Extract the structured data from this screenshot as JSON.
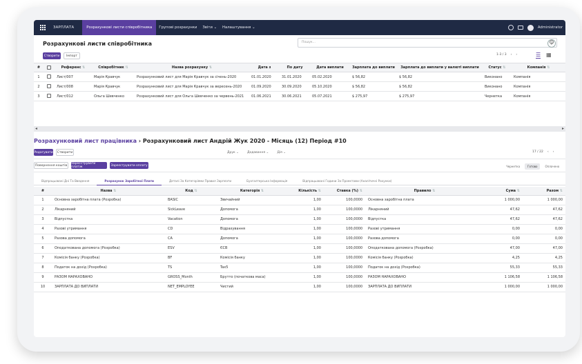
{
  "nav": {
    "brand": "ЗАРПЛАТА",
    "items": [
      "Розрахункові листи співробітника",
      "Групові розрахунки",
      "Звіти ⌄",
      "Налаштування ⌄"
    ],
    "user": "Administrator"
  },
  "list_view": {
    "title": "Розрахункові листи співробітника",
    "create_label": "Створити",
    "import_label": "Імпорт",
    "search_placeholder": "Пошук...",
    "pager": "1-3 / 3",
    "columns": [
      "#",
      "Референс",
      "Співробітник",
      "Назва розрахунку",
      "Дата з",
      "По дату",
      "Дата виплати",
      "Зарплата до виплати",
      "Зарплата до виплати у валюті виплати",
      "Статус",
      "Компанія"
    ],
    "rows": [
      {
        "n": "1",
        "ref": "Лист/007",
        "emp": "Марія Кравчук",
        "name": "Розрахунковий лист для Марія Кравчук за січень-2020",
        "from": "01.01.2020",
        "to": "31.01.2020",
        "pay": "05.02.2020",
        "net": "$ 56,82",
        "net_cur": "$ 56,82",
        "status": "Виконано",
        "company": "Компанія"
      },
      {
        "n": "2",
        "ref": "Лист/008",
        "emp": "Марія Кравчук",
        "name": "Розрахунковий лист для Марія Кравчук за вересень-2020",
        "from": "01.09.2020",
        "to": "30.09.2020",
        "pay": "05.10.2020",
        "net": "$ 56,82",
        "net_cur": "$ 56,82",
        "status": "Виконано",
        "company": "Компанія"
      },
      {
        "n": "3",
        "ref": "Лист/012",
        "emp": "Ольга Шевченко",
        "name": "Розрахунковий лист для Ольга Шевченко за червень-2021",
        "from": "01.06.2021",
        "to": "30.06.2021",
        "pay": "05.07.2021",
        "net": "$ 275,97",
        "net_cur": "$ 275,97",
        "status": "Чернетка",
        "company": "Компанія"
      }
    ]
  },
  "form_view": {
    "breadcrumb_parent": "Розрахунковий лист працівника",
    "breadcrumb_sep": " › ",
    "breadcrumb_current": "Розрахунковий лист Андрій Жук 2020 - Місяць (12) Період #10",
    "edit_label": "Редагувати",
    "create_label": "Створити",
    "menus": [
      "Друк ⌄",
      "Додавання ⌄",
      "Дія ⌄"
    ],
    "pager": "17 / 22",
    "actions": [
      "Повернення коштів",
      "Зареєструвати платіж",
      "Зареєструвати оплату"
    ],
    "statuses": [
      "Чернетка",
      "Готово",
      "Оплачено"
    ],
    "tabs": [
      "Відпрацьовані Дні Та Введення",
      "Розрахунок Заробітної Плати",
      "Деталі За Категоріями Правил Зарплати",
      "Бухгалтерська Інформація",
      "Відпрацьовані Години За Проектами (Аналітичні Рахунки)"
    ],
    "columns": [
      "#",
      "Назва",
      "Код",
      "Категорія",
      "Кількість",
      "Ставка (%)",
      "Правило",
      "Сума",
      "Разом"
    ],
    "lines": [
      [
        "1",
        "Основна заробітна плата (Розробка)",
        "BASIC",
        "Звичайний",
        "1,00",
        "100,0000",
        "Основна заробітна плата",
        "1 000,00",
        "1 000,00"
      ],
      [
        "2",
        "Лікарняний",
        "SickLeave",
        "Допомога",
        "1,00",
        "100,0000",
        "Лікарняний",
        "47,62",
        "47,62"
      ],
      [
        "3",
        "Відпустка",
        "Vacation",
        "Допомога",
        "1,00",
        "100,0000",
        "Відпустка",
        "47,62",
        "47,62"
      ],
      [
        "4",
        "Разові утримання",
        "CD",
        "Відрахування",
        "1,00",
        "100,0000",
        "Разові утримання",
        "0,00",
        "0,00"
      ],
      [
        "5",
        "Разова допомога",
        "CA",
        "Допомога",
        "1,00",
        "100,0000",
        "Разова допомога",
        "0,00",
        "0,00"
      ],
      [
        "6",
        "Оподаткована допомога (Розробка)",
        "ESV",
        "ЄСВ",
        "1,00",
        "100,0000",
        "Оподаткована допомога (Розробка)",
        "47,00",
        "47,00"
      ],
      [
        "7",
        "Комісія банку (Розробка)",
        "BF",
        "Комісія банку",
        "1,00",
        "100,0000",
        "Комісія банку (Розробка)",
        "4,25",
        "4,25"
      ],
      [
        "8",
        "Податок на дохід (Розробка)",
        "TS",
        "Tax5",
        "1,00",
        "100,0000",
        "Податок на дохід (Розробка)",
        "55,33",
        "55,33"
      ],
      [
        "9",
        "РАЗОМ НАРАХОВАНО",
        "GROSS_Month",
        "Брутто (початкова маса)",
        "1,00",
        "100,0000",
        "РАЗОМ НАРАХОВАНО",
        "1 106,58",
        "1 106,58"
      ],
      [
        "10",
        "ЗАРПЛАТА ДО ВИПЛАТИ",
        "NET_EMPLOYEE",
        "Чистий",
        "1,00",
        "100,0000",
        "ЗАРПЛАТА ДО ВИПЛАТИ",
        "1 000,00",
        "1 000,00"
      ]
    ]
  },
  "colors": {
    "accent": "#5a3fa0",
    "topbar": "#1f2a44"
  }
}
